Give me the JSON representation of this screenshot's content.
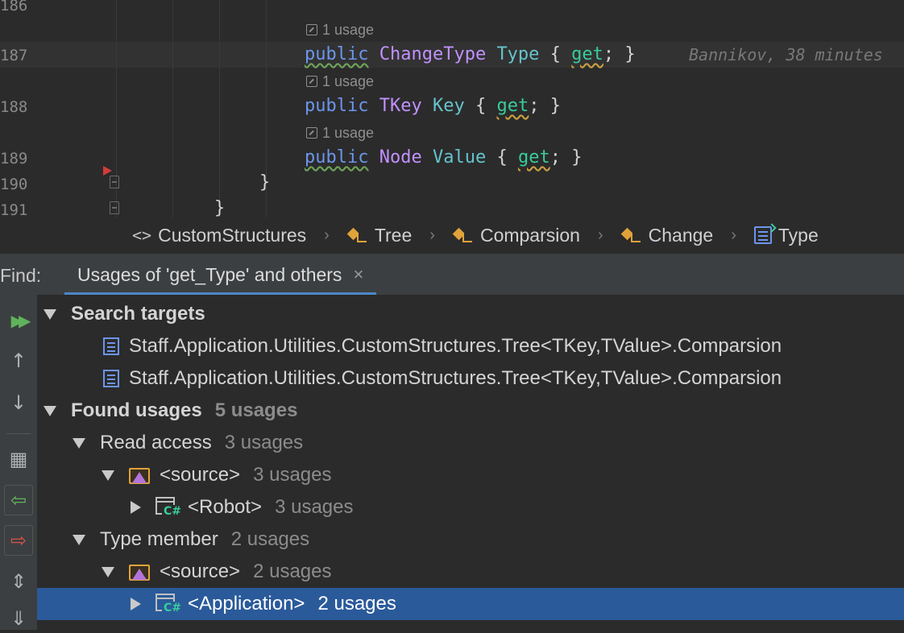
{
  "editor": {
    "lines": [
      {
        "num": "186"
      },
      {
        "num": "187",
        "hint": "1 usage",
        "kw": "public",
        "type": "ChangeType",
        "prop": "Type",
        "open": "{",
        "acc": "get",
        "semi": ";",
        "close": "}",
        "blame": "Bannikov, 38 minutes"
      },
      {
        "num": "188",
        "hint": "1 usage",
        "kw": "public",
        "type": "TKey",
        "prop": "Key",
        "open": "{",
        "acc": "get",
        "semi": ";",
        "close": "}"
      },
      {
        "num": "189",
        "hint": "1 usage",
        "kw": "public",
        "type": "Node",
        "prop": "Value",
        "open": "{",
        "acc": "get",
        "semi": ";",
        "close": "}"
      },
      {
        "num": "190",
        "brace": "}"
      },
      {
        "num": "191",
        "brace": "}"
      }
    ]
  },
  "breadcrumbs": [
    {
      "label": "CustomStructures",
      "icon": "namespace-icon"
    },
    {
      "label": "Tree",
      "icon": "class-icon"
    },
    {
      "label": "Comparsion",
      "icon": "class-icon"
    },
    {
      "label": "Change",
      "icon": "class-icon"
    },
    {
      "label": "Type",
      "icon": "property-icon"
    }
  ],
  "find": {
    "label": "Find:",
    "tab_label": "Usages of 'get_Type' and others",
    "tab_close": "×",
    "toolbar": {
      "rerun": "▶▶",
      "up": "↑",
      "down": "↓",
      "group": "▦",
      "prev": "⇦",
      "next": "⇨",
      "expand": "⇕",
      "collapse": "⇓"
    },
    "tree": {
      "search_targets": {
        "label": "Search targets",
        "items": [
          "Staff.Application.Utilities.CustomStructures.Tree<TKey,TValue>.Comparsion",
          "Staff.Application.Utilities.CustomStructures.Tree<TKey,TValue>.Comparsion"
        ]
      },
      "found_usages": {
        "label": "Found usages",
        "count": "5 usages"
      },
      "read_access": {
        "label": "Read access",
        "count": "3 usages"
      },
      "read_source": {
        "label": "<source>",
        "count": "3 usages"
      },
      "robot": {
        "label": "<Robot>",
        "count": "3 usages"
      },
      "type_member": {
        "label": "Type member",
        "count": "2 usages"
      },
      "type_source": {
        "label": "<source>",
        "count": "2 usages"
      },
      "application": {
        "label": "<Application>",
        "count": "2 usages"
      }
    }
  },
  "colors": {
    "accent": "#4a88c7",
    "selected_row": "#2a5a9a",
    "keyword": "#6c95eb",
    "type": "#c191ff",
    "property": "#66c3cc",
    "accessor": "#39cc9b"
  },
  "cs_badge": "C#"
}
